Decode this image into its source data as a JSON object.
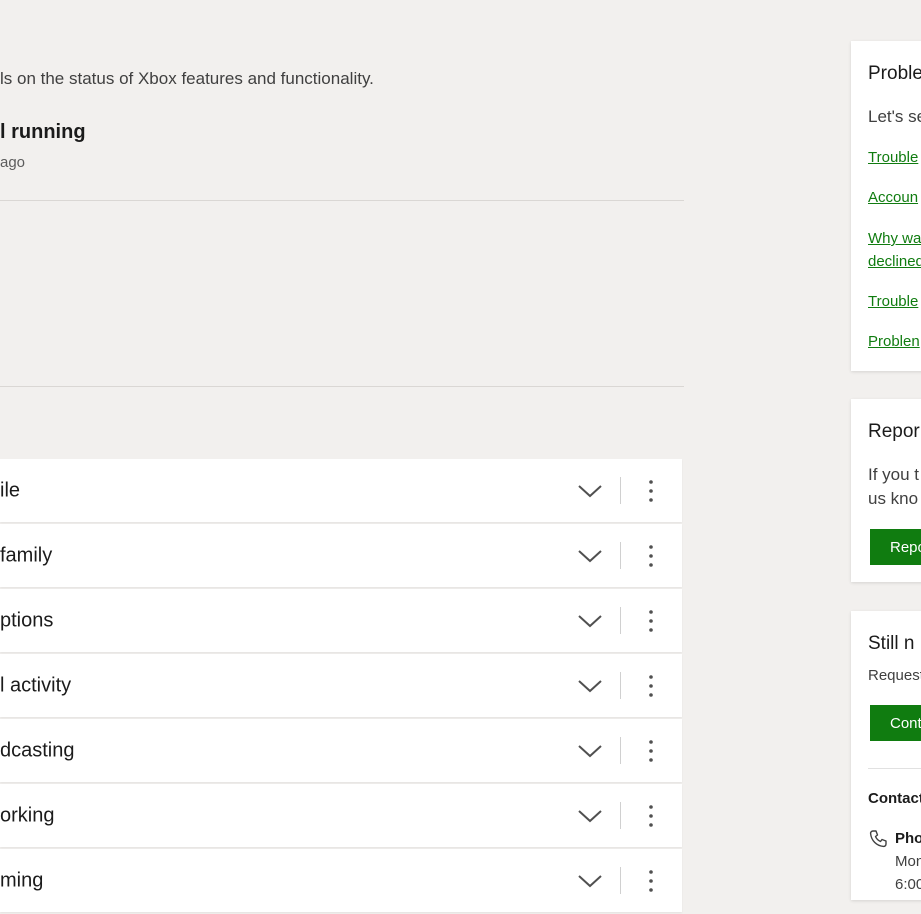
{
  "intro": "ls on the status of Xbox features and functionality.",
  "status": {
    "title": "l running",
    "updated": "ago"
  },
  "services": [
    {
      "label": "ile"
    },
    {
      "label": "family"
    },
    {
      "label": "ptions"
    },
    {
      "label": "l activity"
    },
    {
      "label": "dcasting"
    },
    {
      "label": "orking"
    },
    {
      "label": "ming"
    }
  ],
  "sidebar": {
    "problems": {
      "title": "Proble",
      "text": "Let's se",
      "links": [
        "Trouble",
        "Accoun",
        "Why wa",
        "declined",
        "Trouble",
        "Problen"
      ]
    },
    "report": {
      "title": "Repor",
      "text_line1": "If you t",
      "text_line2": "us kno",
      "button": "Repo"
    },
    "still_need_help": {
      "title": "Still n",
      "text": "Request",
      "button": "Cont",
      "contact_label": "Contact",
      "phone_title": "Pho",
      "phone_line1": "Mon",
      "phone_line2": "6:00"
    }
  },
  "colors": {
    "page_background": "#f2f0ee",
    "card_background": "#ffffff",
    "accent_green": "#107c10",
    "link_green": "#107c10"
  },
  "icons": {
    "expand": "chevron-down-icon",
    "more": "more-vertical-icon",
    "phone": "phone-icon"
  }
}
